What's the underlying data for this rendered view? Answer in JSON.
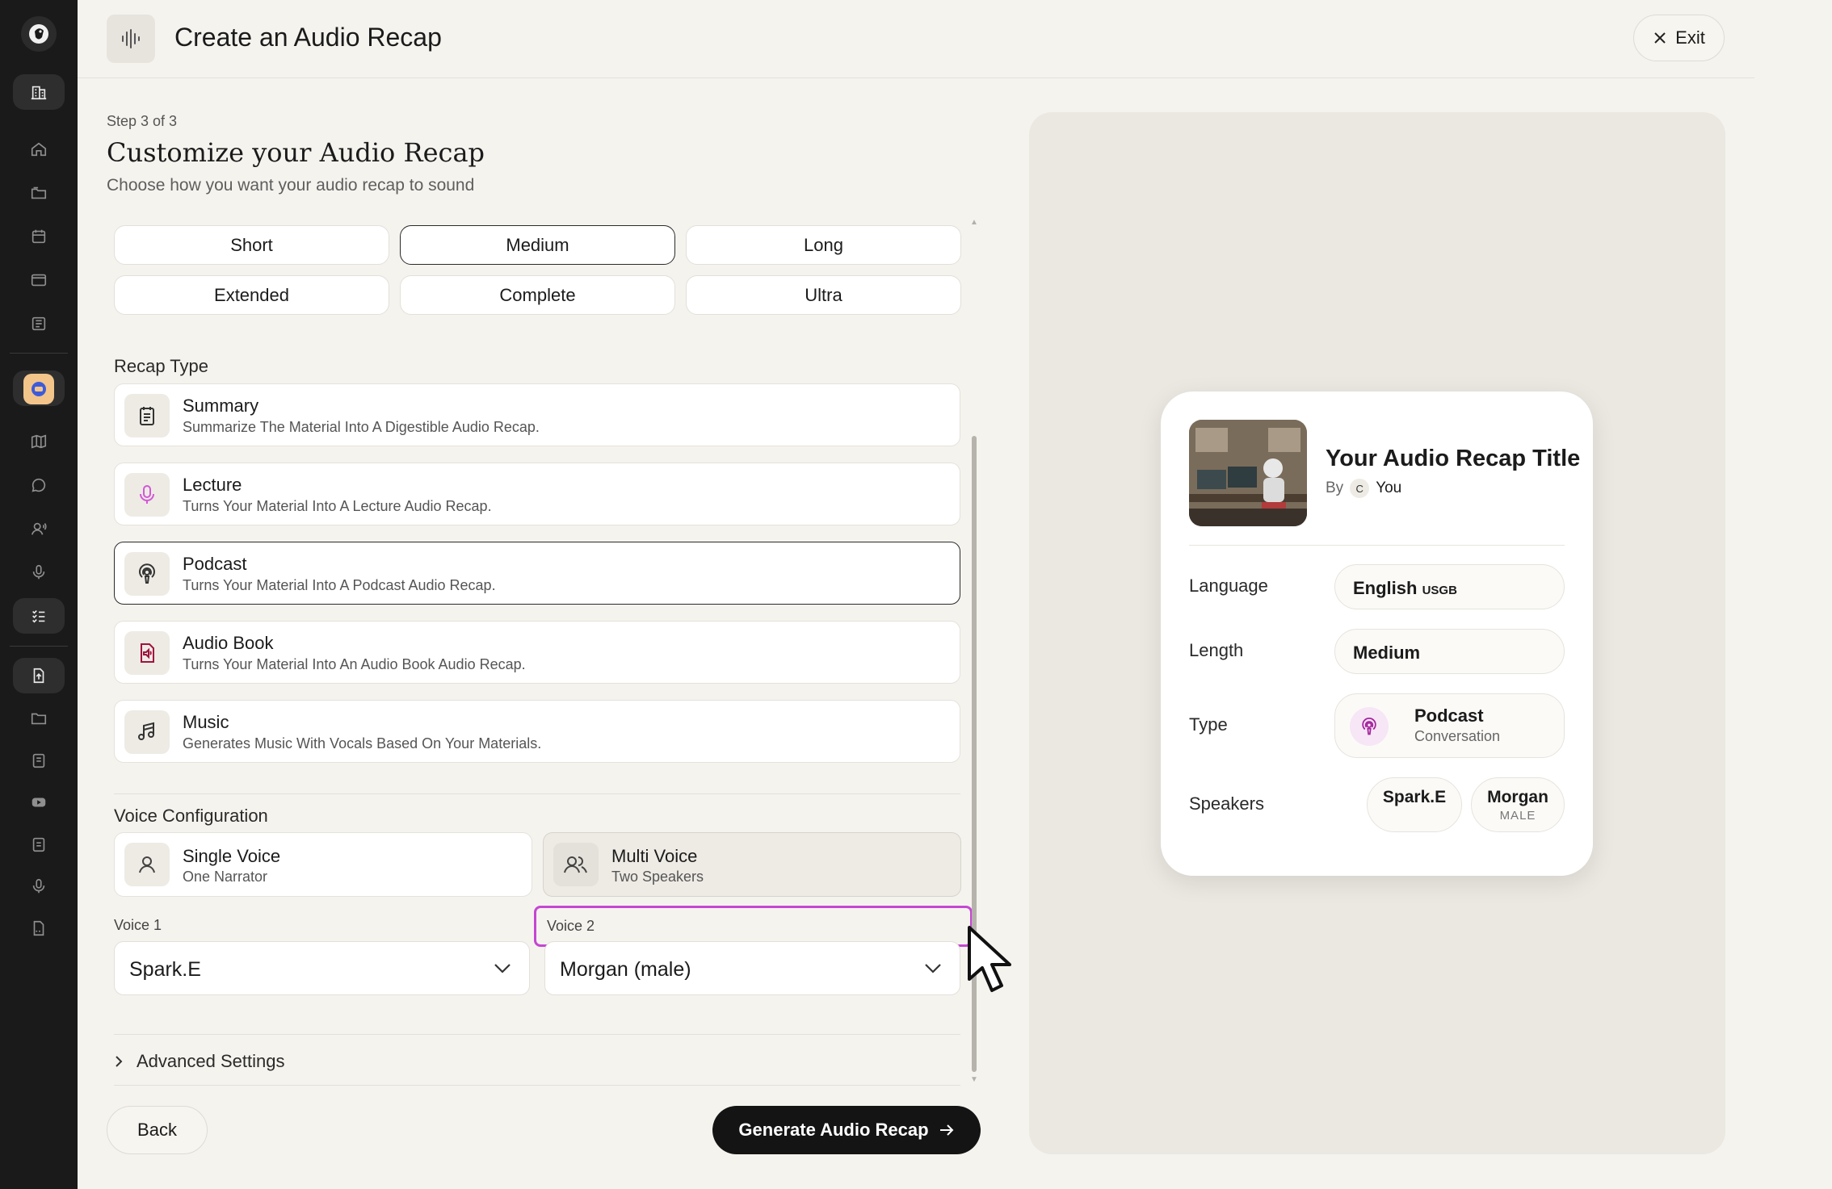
{
  "header": {
    "title": "Create an Audio Recap",
    "exit_label": "Exit"
  },
  "step": {
    "label": "Step 3 of 3",
    "title": "Customize your Audio Recap",
    "subtitle": "Choose how you want your audio recap to sound"
  },
  "length_options": {
    "selected": "Medium",
    "items": [
      {
        "label": "Short"
      },
      {
        "label": "Medium"
      },
      {
        "label": "Long"
      },
      {
        "label": "Extended"
      },
      {
        "label": "Complete"
      },
      {
        "label": "Ultra"
      }
    ]
  },
  "recap_type": {
    "label": "Recap Type",
    "selected": "Podcast",
    "items": [
      {
        "title": "Summary",
        "desc": "Summarize The Material Into A Digestible Audio Recap.",
        "icon": "notepad-icon"
      },
      {
        "title": "Lecture",
        "desc": "Turns Your Material Into A Lecture Audio Recap.",
        "icon": "microphone-icon"
      },
      {
        "title": "Podcast",
        "desc": "Turns Your Material Into A Podcast Audio Recap.",
        "icon": "podcast-icon"
      },
      {
        "title": "Audio Book",
        "desc": "Turns Your Material Into An Audio Book Audio Recap.",
        "icon": "audio-file-icon"
      },
      {
        "title": "Music",
        "desc": "Generates Music With Vocals Based On Your Materials.",
        "icon": "music-note-icon"
      }
    ]
  },
  "voice_config": {
    "label": "Voice Configuration",
    "selected": "Multi Voice",
    "single": {
      "title": "Single Voice",
      "desc": "One Narrator"
    },
    "multi": {
      "title": "Multi Voice",
      "desc": "Two Speakers"
    },
    "voice1": {
      "label": "Voice 1",
      "value": "Spark.E"
    },
    "voice2": {
      "label": "Voice 2",
      "value": "Morgan (male)"
    }
  },
  "advanced": {
    "label": "Advanced Settings"
  },
  "footer": {
    "back_label": "Back",
    "generate_label": "Generate Audio Recap"
  },
  "preview": {
    "title": "Your Audio Recap Title",
    "by_label": "By",
    "author_initial": "C",
    "author": "You",
    "language_label": "Language",
    "language_value": "English",
    "language_variant": "USGB",
    "length_label": "Length",
    "length_value": "Medium",
    "type_label": "Type",
    "type_value": "Podcast",
    "type_sub": "Conversation",
    "speakers_label": "Speakers",
    "speakers": [
      {
        "name": "Spark.E",
        "sub": ""
      },
      {
        "name": "Morgan",
        "sub": "MALE"
      }
    ]
  },
  "colors": {
    "accent_focus": "#c546d3",
    "primary_button": "#141414",
    "sidebar_bg": "#1a1a1a",
    "page_bg": "#f5f3ee"
  }
}
